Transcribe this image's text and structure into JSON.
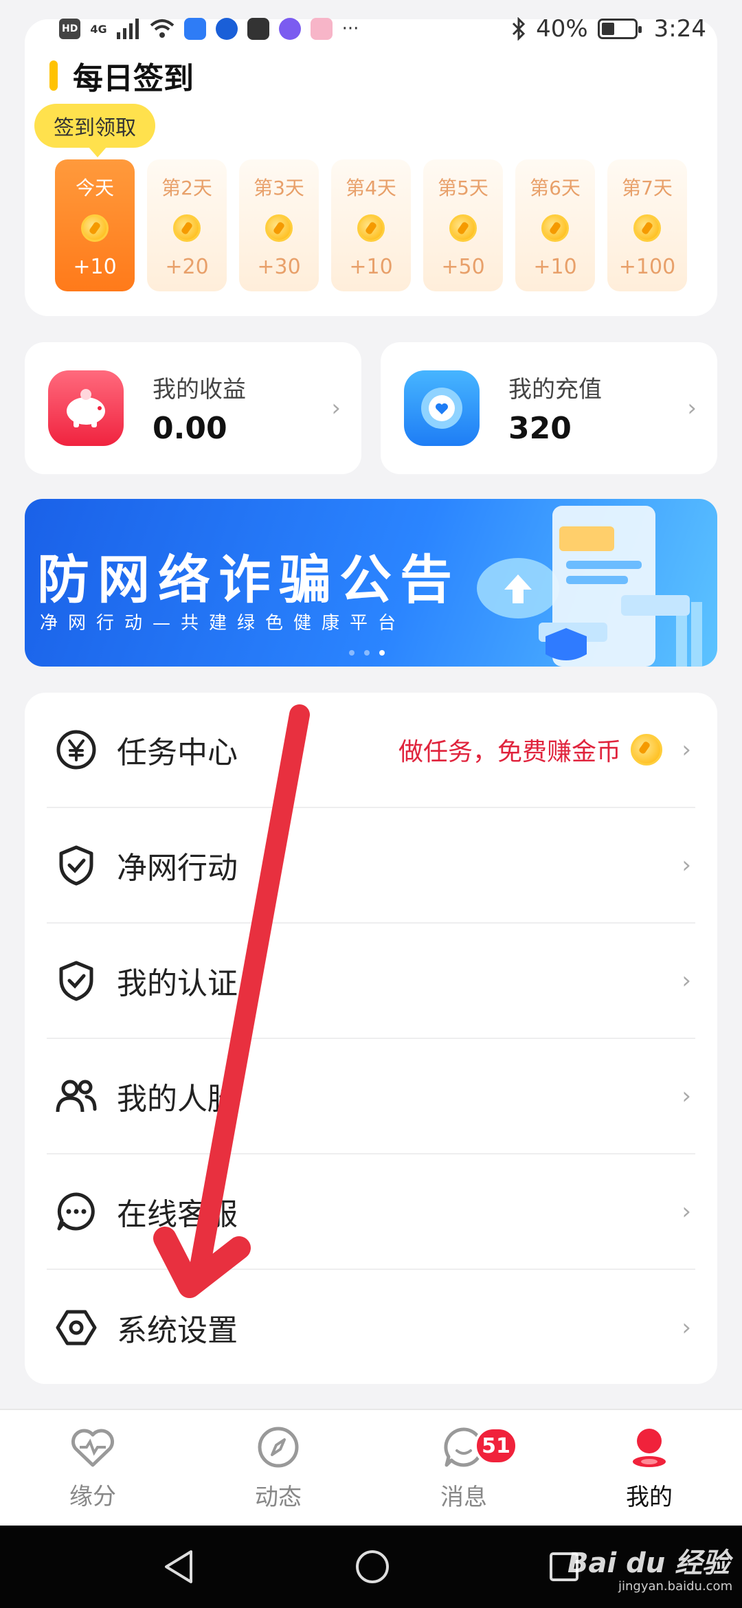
{
  "status_bar": {
    "hd": "HD",
    "network": "4G",
    "battery_percent": "40%",
    "battery_level": 0.4,
    "time": "3:24",
    "more": "···"
  },
  "checkin": {
    "title": "每日签到",
    "bubble": "签到领取",
    "days": [
      {
        "label": "今天",
        "reward": "+10"
      },
      {
        "label": "第2天",
        "reward": "+20"
      },
      {
        "label": "第3天",
        "reward": "+30"
      },
      {
        "label": "第4天",
        "reward": "+10"
      },
      {
        "label": "第5天",
        "reward": "+50"
      },
      {
        "label": "第6天",
        "reward": "+10"
      },
      {
        "label": "第7天",
        "reward": "+100"
      }
    ]
  },
  "stats": {
    "earnings": {
      "label": "我的收益",
      "value": "0.00"
    },
    "recharge": {
      "label": "我的充值",
      "value": "320"
    }
  },
  "banner": {
    "title": "防网络诈骗公告",
    "subtitle": "净网行动—共建绿色健康平台"
  },
  "menu": {
    "items": [
      {
        "label": "任务中心",
        "icon": "yuan-icon",
        "extra": "做任务，免费赚金币"
      },
      {
        "label": "净网行动",
        "icon": "shield-icon"
      },
      {
        "label": "我的认证",
        "icon": "shield-check-icon"
      },
      {
        "label": "我的人脉",
        "icon": "people-icon"
      },
      {
        "label": "在线客服",
        "icon": "chat-icon"
      },
      {
        "label": "系统设置",
        "icon": "hexagon-settings-icon"
      }
    ]
  },
  "bottom_nav": {
    "items": [
      {
        "label": "缘分",
        "icon": "heart-pulse-icon"
      },
      {
        "label": "动态",
        "icon": "compass-icon"
      },
      {
        "label": "消息",
        "icon": "message-icon",
        "badge": "51"
      },
      {
        "label": "我的",
        "icon": "profile-icon",
        "active": true
      }
    ]
  },
  "watermark": {
    "brand": "Bai du 经验",
    "url": "jingyan.baidu.com"
  },
  "colors": {
    "accent": "#ff7a1a",
    "highlight": "#e0243d",
    "badge": "#f0223b",
    "annotation_arrow": "#e8303f"
  }
}
